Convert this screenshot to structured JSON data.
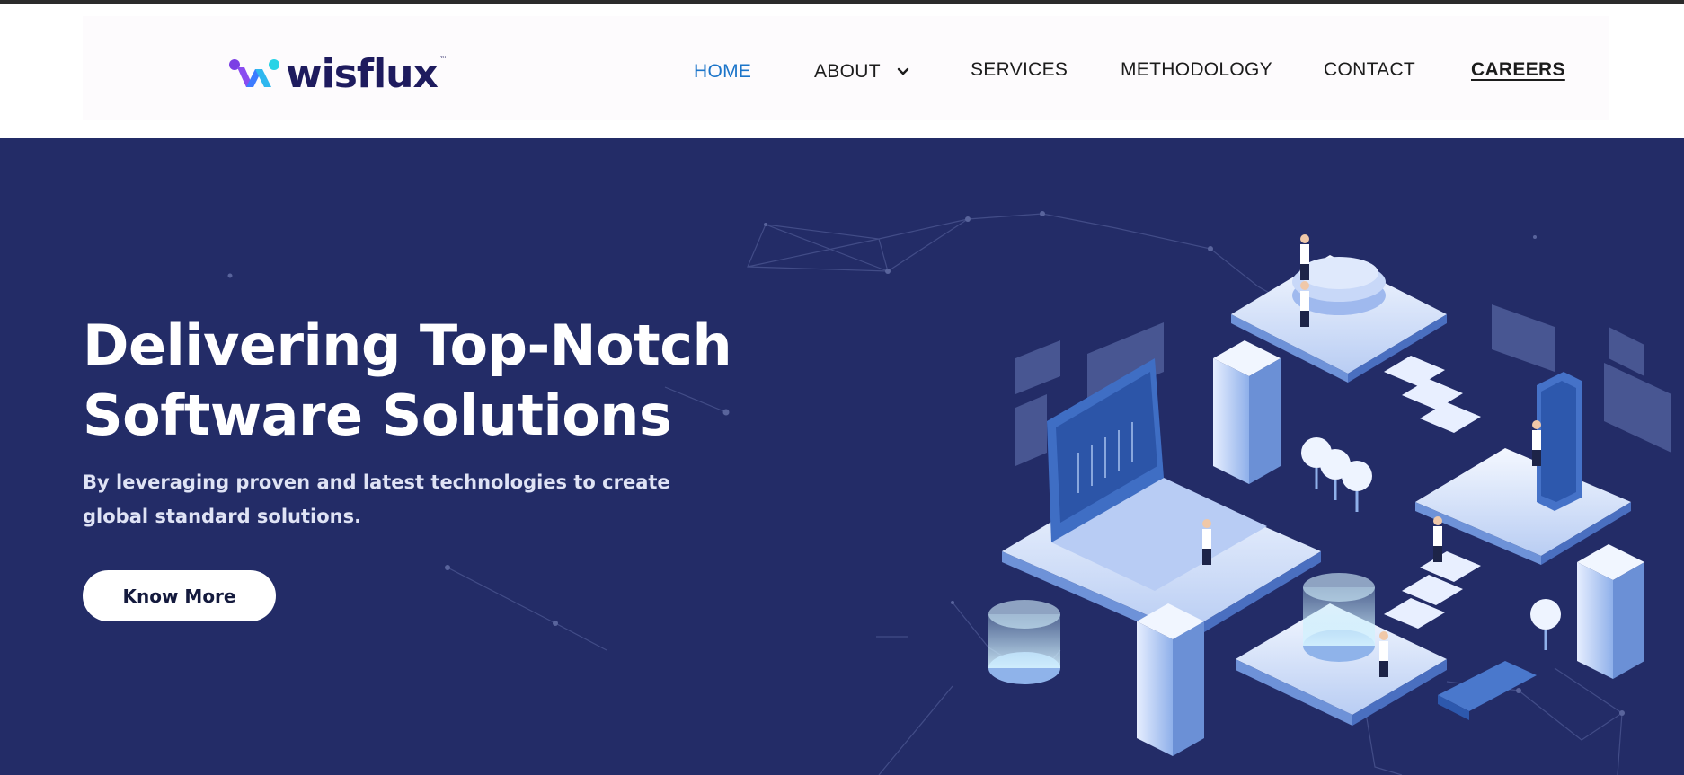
{
  "brand": {
    "name": "wisflux",
    "trademark": "™",
    "logo_colors": [
      "#7b3fe4",
      "#3d7bff",
      "#27d3e6"
    ],
    "text_color": "#1e1b5e"
  },
  "nav": {
    "items": [
      {
        "label": "HOME",
        "active": true
      },
      {
        "label": "ABOUT",
        "has_dropdown": true,
        "icon": "chevron-down-icon"
      },
      {
        "label": "SERVICES"
      },
      {
        "label": "METHODOLOGY"
      },
      {
        "label": "CONTACT"
      },
      {
        "label": "CAREERS",
        "underlined": true
      }
    ],
    "active_color": "#1b74c9"
  },
  "hero": {
    "title_line1": "Delivering Top-Notch",
    "title_line2": "Software Solutions",
    "subtitle_line1": "By leveraging proven and latest technologies to create",
    "subtitle_line2": "global standard solutions.",
    "cta_label": "Know More",
    "background_color": "#232c67"
  }
}
